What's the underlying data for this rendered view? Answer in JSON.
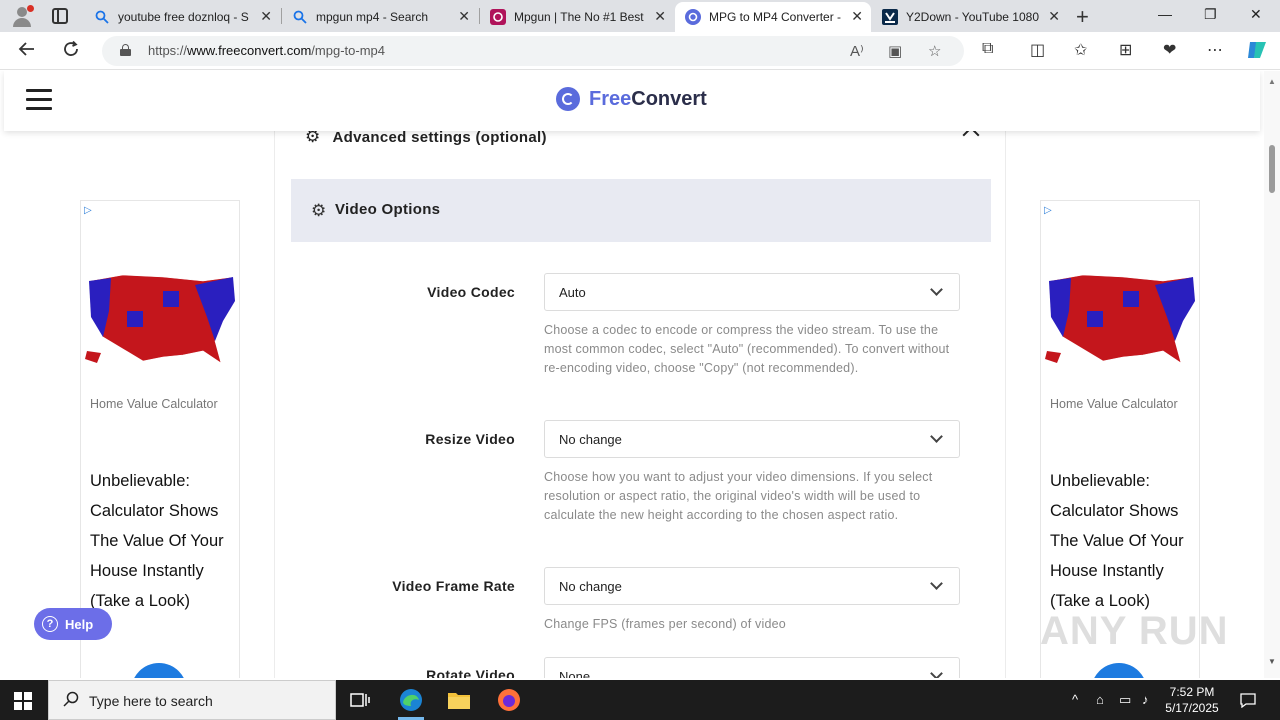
{
  "browser": {
    "tabs": [
      {
        "label": "youtube free doznloq - S",
        "icon": "search-icon"
      },
      {
        "label": "mpgun mp4 - Search",
        "icon": "search-icon"
      },
      {
        "label": "Mpgun | The No #1 Best",
        "icon": "mpgun-favicon"
      },
      {
        "label": "MPG to MP4 Converter -",
        "icon": "freeconvert-favicon"
      },
      {
        "label": "Y2Down - YouTube 1080",
        "icon": "y2down-favicon"
      }
    ],
    "url_prefix": "https://",
    "url_host": "www.freeconvert.com",
    "url_path": "/mpg-to-mp4"
  },
  "site": {
    "logo_part1": "Free",
    "logo_part2": "Convert",
    "advanced_settings": "Advanced settings (optional)",
    "video_options": "Video Options",
    "help_button": "Help"
  },
  "options": [
    {
      "label": "Video Codec",
      "value": "Auto",
      "help": "Choose a codec to encode or compress the video stream. To use the most common codec, select \"Auto\" (recommended). To convert without re-encoding video, choose \"Copy\" (not recommended)."
    },
    {
      "label": "Resize Video",
      "value": "No change",
      "help": "Choose how you want to adjust your video dimensions. If you select resolution or aspect ratio, the original video's width will be used to calculate the new height according to the chosen aspect ratio."
    },
    {
      "label": "Video Frame Rate",
      "value": "No change",
      "help": "Change FPS (frames per second) of video"
    },
    {
      "label": "Rotate Video",
      "value": "None",
      "help": ""
    }
  ],
  "ad": {
    "source": "Home Value Calculator",
    "headline": "Unbelievable: Calculator Shows The Value Of Your House Instantly (Take a Look)"
  },
  "watermark": "ANY RUN",
  "taskbar": {
    "search_placeholder": "Type here to search",
    "time": "7:52 PM",
    "date": "5/17/2025"
  },
  "colors": {
    "brand": "#5a6bdc",
    "band": "#e8eaf2",
    "help_button": "#6c6ee8"
  }
}
